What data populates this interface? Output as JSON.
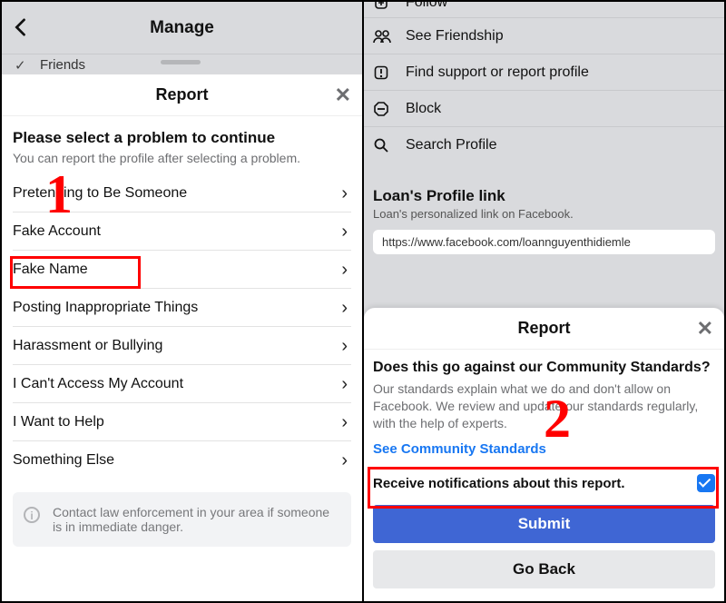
{
  "left": {
    "nav_title": "Manage",
    "friends_label": "Friends",
    "sheet_title": "Report",
    "prompt_title": "Please select a problem to continue",
    "prompt_sub": "You can report the profile after selecting a problem.",
    "options": [
      "Pretending to Be Someone",
      "Fake Account",
      "Fake Name",
      "Posting Inappropriate Things",
      "Harassment or Bullying",
      "I Can't Access My Account",
      "I Want to Help",
      "Something Else"
    ],
    "law_notice": "Contact law enforcement in your area if someone is in immediate danger."
  },
  "right": {
    "profile_opts": [
      "Follow",
      "See Friendship",
      "Find support or report profile",
      "Block",
      "Search Profile"
    ],
    "profile_link_title": "Loan's Profile link",
    "profile_link_sub": "Loan's personalized link on Facebook.",
    "profile_url": "https://www.facebook.com/loannguyenthidiemle",
    "sheet_title": "Report",
    "cs_question": "Does this go against our Community Standards?",
    "cs_desc": "Our standards explain what we do and don't allow on Facebook. We review and update our standards regularly, with the help of experts.",
    "cs_link": "See Community Standards",
    "notif_label": "Receive notifications about this report.",
    "submit_label": "Submit",
    "goback_label": "Go Back"
  },
  "annotations": {
    "num1": "1",
    "num2": "2"
  }
}
